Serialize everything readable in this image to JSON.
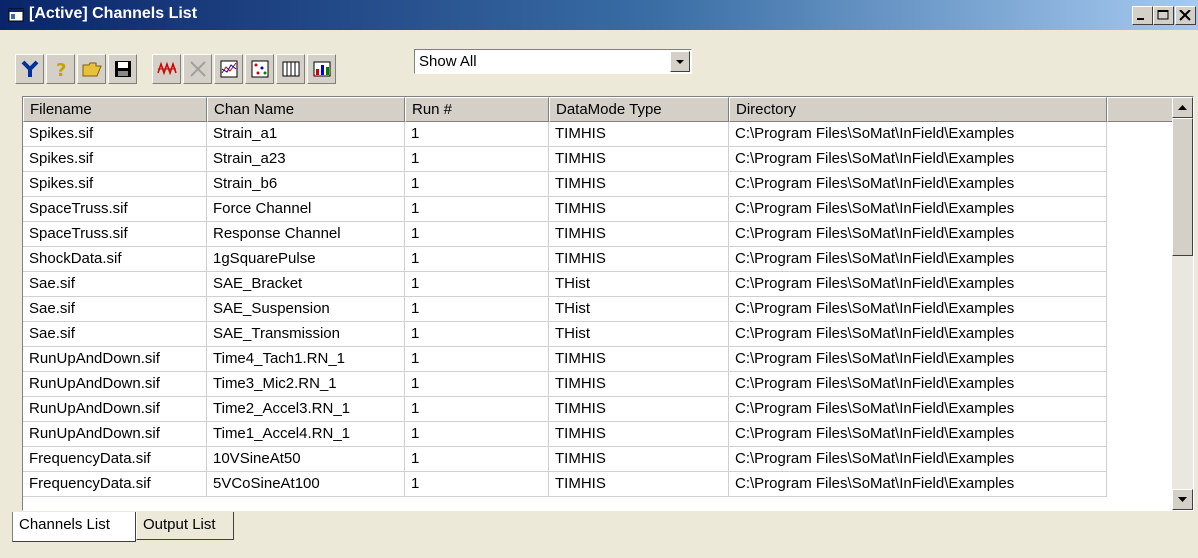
{
  "window": {
    "title": "[Active] Channels List"
  },
  "toolbar": {
    "buttons": [
      "setup-icon",
      "help-icon",
      "open-folder-icon",
      "save-icon",
      "waveform-icon",
      "delete-icon",
      "chart-icon",
      "scatter-icon",
      "grid-icon",
      "stats-icon"
    ],
    "filter_value": "Show All"
  },
  "list": {
    "columns": [
      "Filename",
      "Chan Name",
      "Run #",
      "DataMode Type",
      "Directory"
    ],
    "rows": [
      {
        "file": "Spikes.sif",
        "chan": "Strain_a1",
        "run": "1",
        "mode": "TIMHIS",
        "dir": "C:\\Program Files\\SoMat\\InField\\Examples"
      },
      {
        "file": "Spikes.sif",
        "chan": "Strain_a23",
        "run": "1",
        "mode": "TIMHIS",
        "dir": "C:\\Program Files\\SoMat\\InField\\Examples"
      },
      {
        "file": "Spikes.sif",
        "chan": "Strain_b6",
        "run": "1",
        "mode": "TIMHIS",
        "dir": "C:\\Program Files\\SoMat\\InField\\Examples"
      },
      {
        "file": "SpaceTruss.sif",
        "chan": "Force Channel",
        "run": "1",
        "mode": "TIMHIS",
        "dir": "C:\\Program Files\\SoMat\\InField\\Examples"
      },
      {
        "file": "SpaceTruss.sif",
        "chan": "Response Channel",
        "run": "1",
        "mode": "TIMHIS",
        "dir": "C:\\Program Files\\SoMat\\InField\\Examples"
      },
      {
        "file": "ShockData.sif",
        "chan": "1gSquarePulse",
        "run": "1",
        "mode": "TIMHIS",
        "dir": "C:\\Program Files\\SoMat\\InField\\Examples"
      },
      {
        "file": "Sae.sif",
        "chan": "SAE_Bracket",
        "run": "1",
        "mode": "THist",
        "dir": "C:\\Program Files\\SoMat\\InField\\Examples"
      },
      {
        "file": "Sae.sif",
        "chan": "SAE_Suspension",
        "run": "1",
        "mode": "THist",
        "dir": "C:\\Program Files\\SoMat\\InField\\Examples"
      },
      {
        "file": "Sae.sif",
        "chan": "SAE_Transmission",
        "run": "1",
        "mode": "THist",
        "dir": "C:\\Program Files\\SoMat\\InField\\Examples"
      },
      {
        "file": "RunUpAndDown.sif",
        "chan": "Time4_Tach1.RN_1",
        "run": "1",
        "mode": "TIMHIS",
        "dir": "C:\\Program Files\\SoMat\\InField\\Examples"
      },
      {
        "file": "RunUpAndDown.sif",
        "chan": "Time3_Mic2.RN_1",
        "run": "1",
        "mode": "TIMHIS",
        "dir": "C:\\Program Files\\SoMat\\InField\\Examples"
      },
      {
        "file": "RunUpAndDown.sif",
        "chan": "Time2_Accel3.RN_1",
        "run": "1",
        "mode": "TIMHIS",
        "dir": "C:\\Program Files\\SoMat\\InField\\Examples"
      },
      {
        "file": "RunUpAndDown.sif",
        "chan": "Time1_Accel4.RN_1",
        "run": "1",
        "mode": "TIMHIS",
        "dir": "C:\\Program Files\\SoMat\\InField\\Examples"
      },
      {
        "file": "FrequencyData.sif",
        "chan": "10VSineAt50",
        "run": "1",
        "mode": "TIMHIS",
        "dir": "C:\\Program Files\\SoMat\\InField\\Examples"
      },
      {
        "file": "FrequencyData.sif",
        "chan": "5VCoSineAt100",
        "run": "1",
        "mode": "TIMHIS",
        "dir": "C:\\Program Files\\SoMat\\InField\\Examples"
      }
    ]
  },
  "tabs": [
    "Channels List",
    "Output List"
  ],
  "colors": {
    "titlebar_start": "#0a246a",
    "titlebar_end": "#a6caf0",
    "face": "#ece9d8"
  }
}
